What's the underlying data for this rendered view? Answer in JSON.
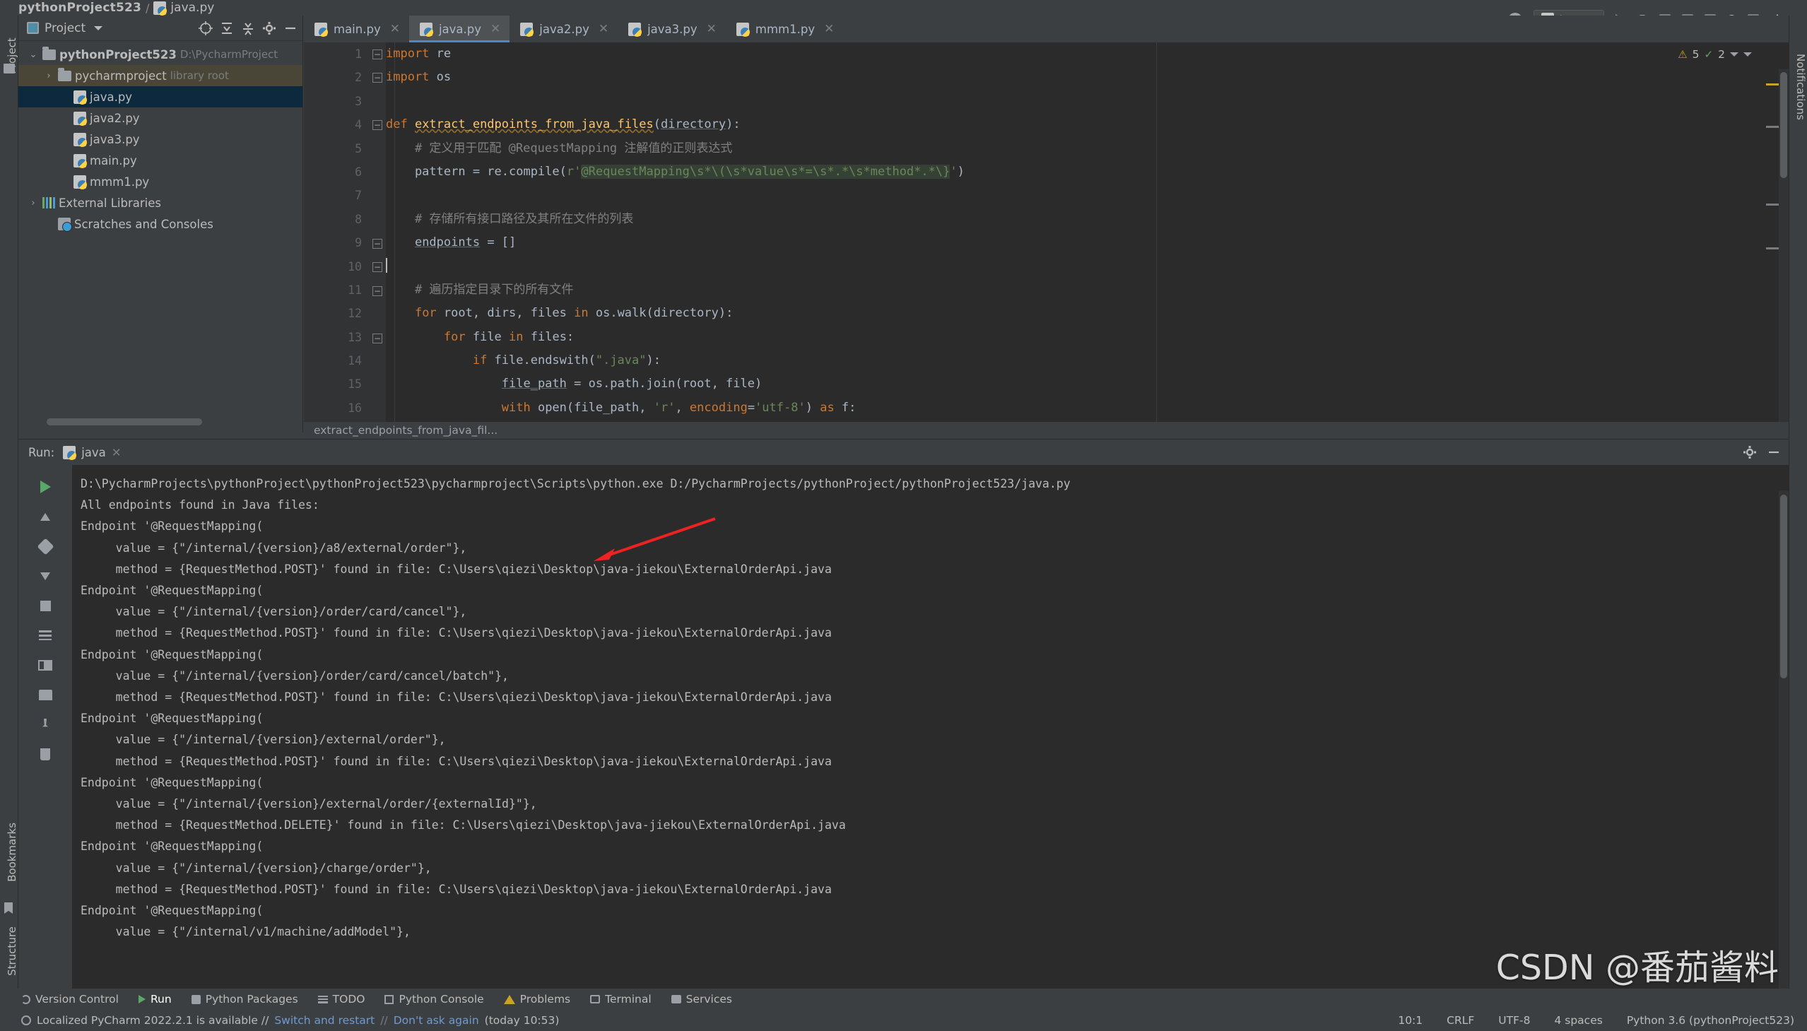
{
  "breadcrumb": {
    "project": "pythonProject523",
    "separator": "/",
    "file": "java.py"
  },
  "left_strip": {
    "project_label": "Project",
    "bookmarks_label": "Bookmarks",
    "structure_label": "Structure"
  },
  "right_strip": {
    "notifications_label": "Notifications"
  },
  "project_panel": {
    "title": "Project",
    "tree": [
      {
        "label": "pythonProject523",
        "hint": "D:\\PycharmProject",
        "icon": "folder-icon",
        "bold": true,
        "arrow": "⌄",
        "depth": 0,
        "state": "normal"
      },
      {
        "label": "pycharmproject",
        "hint": "library root",
        "icon": "folder-icon",
        "bold": false,
        "arrow": "›",
        "depth": 1,
        "state": "highlight"
      },
      {
        "label": "java.py",
        "hint": "",
        "icon": "python-file-icon",
        "bold": false,
        "arrow": "",
        "depth": 2,
        "state": "selected"
      },
      {
        "label": "java2.py",
        "hint": "",
        "icon": "python-file-icon",
        "bold": false,
        "arrow": "",
        "depth": 2,
        "state": "normal"
      },
      {
        "label": "java3.py",
        "hint": "",
        "icon": "python-file-icon",
        "bold": false,
        "arrow": "",
        "depth": 2,
        "state": "normal"
      },
      {
        "label": "main.py",
        "hint": "",
        "icon": "python-file-icon",
        "bold": false,
        "arrow": "",
        "depth": 2,
        "state": "normal"
      },
      {
        "label": "mmm1.py",
        "hint": "",
        "icon": "python-file-icon",
        "bold": false,
        "arrow": "",
        "depth": 2,
        "state": "normal"
      },
      {
        "label": "External Libraries",
        "hint": "",
        "icon": "library-icon",
        "bold": false,
        "arrow": "›",
        "depth": 0,
        "state": "normal"
      },
      {
        "label": "Scratches and Consoles",
        "hint": "",
        "icon": "scratches-icon",
        "bold": false,
        "arrow": "",
        "depth": 1,
        "state": "normal"
      }
    ]
  },
  "editor": {
    "tabs": [
      {
        "label": "main.py",
        "active": false
      },
      {
        "label": "java.py",
        "active": true
      },
      {
        "label": "java2.py",
        "active": false
      },
      {
        "label": "java3.py",
        "active": false
      },
      {
        "label": "mmm1.py",
        "active": false
      }
    ],
    "inspection": {
      "warnings": "5",
      "checks": "2"
    },
    "breadcrumb_bottom": "extract_endpoints_from_java_fil...",
    "line_numbers": [
      "1",
      "2",
      "3",
      "4",
      "5",
      "6",
      "7",
      "8",
      "9",
      "10",
      "11",
      "12",
      "13",
      "14",
      "15",
      "16"
    ],
    "code": [
      {
        "n": 1,
        "tokens": [
          {
            "t": "import",
            "c": "kw"
          },
          {
            "t": " re",
            "c": "var"
          }
        ]
      },
      {
        "n": 2,
        "tokens": [
          {
            "t": "import",
            "c": "kw"
          },
          {
            "t": " os",
            "c": "var"
          }
        ]
      },
      {
        "n": 3,
        "tokens": []
      },
      {
        "n": 4,
        "tokens": [
          {
            "t": "def ",
            "c": "kw"
          },
          {
            "t": "extract_endpoints_from_java_files",
            "c": "fndef"
          },
          {
            "t": "(",
            "c": "var"
          },
          {
            "t": "directory",
            "c": "varu"
          },
          {
            "t": "):",
            "c": "var"
          }
        ]
      },
      {
        "n": 5,
        "tokens": [
          {
            "t": "    # 定义用于匹配 @RequestMapping 注解值的正则表达式",
            "c": "cmt"
          }
        ]
      },
      {
        "n": 6,
        "tokens": [
          {
            "t": "    pattern = re.compile(",
            "c": "var"
          },
          {
            "t": "r'",
            "c": "str"
          },
          {
            "t": "@RequestMapping\\s*\\(\\s*value\\s*=\\s*.*\\s*method*.*\\",
            "c": "strhl"
          },
          {
            "t": "}",
            "c": "strhl"
          },
          {
            "t": "'",
            "c": "str"
          },
          {
            "t": ")",
            "c": "var"
          }
        ]
      },
      {
        "n": 7,
        "tokens": []
      },
      {
        "n": 8,
        "tokens": [
          {
            "t": "    # 存储所有接口路径及其所在文件的列表",
            "c": "cmt"
          }
        ]
      },
      {
        "n": 9,
        "tokens": [
          {
            "t": "    ",
            "c": "var"
          },
          {
            "t": "endpoints",
            "c": "varu"
          },
          {
            "t": " = []",
            "c": "var"
          }
        ]
      },
      {
        "n": 10,
        "tokens": [],
        "caret": true
      },
      {
        "n": 11,
        "tokens": [
          {
            "t": "    # 遍历指定目录下的所有文件",
            "c": "cmt"
          }
        ]
      },
      {
        "n": 12,
        "tokens": [
          {
            "t": "    ",
            "c": "var"
          },
          {
            "t": "for",
            "c": "kw"
          },
          {
            "t": " root, dirs, files ",
            "c": "var"
          },
          {
            "t": "in",
            "c": "kw"
          },
          {
            "t": " os.walk(directory):",
            "c": "var"
          }
        ]
      },
      {
        "n": 13,
        "tokens": [
          {
            "t": "        ",
            "c": "var"
          },
          {
            "t": "for",
            "c": "kw"
          },
          {
            "t": " file ",
            "c": "var"
          },
          {
            "t": "in",
            "c": "kw"
          },
          {
            "t": " files:",
            "c": "var"
          }
        ]
      },
      {
        "n": 14,
        "tokens": [
          {
            "t": "            ",
            "c": "var"
          },
          {
            "t": "if",
            "c": "kw"
          },
          {
            "t": " file.endswith(",
            "c": "var"
          },
          {
            "t": "\".java\"",
            "c": "str"
          },
          {
            "t": "):",
            "c": "var"
          }
        ]
      },
      {
        "n": 15,
        "tokens": [
          {
            "t": "                ",
            "c": "var"
          },
          {
            "t": "file_path",
            "c": "varu"
          },
          {
            "t": " = os.path.join(root, file)",
            "c": "var"
          }
        ]
      },
      {
        "n": 16,
        "tokens": [
          {
            "t": "                ",
            "c": "var"
          },
          {
            "t": "with",
            "c": "kw"
          },
          {
            "t": " open(file_path, ",
            "c": "var"
          },
          {
            "t": "'r'",
            "c": "str"
          },
          {
            "t": ", ",
            "c": "var"
          },
          {
            "t": "encoding",
            "c": "kw"
          },
          {
            "t": "=",
            "c": "var"
          },
          {
            "t": "'utf-8'",
            "c": "str"
          },
          {
            "t": ") ",
            "c": "var"
          },
          {
            "t": "as",
            "c": "kw"
          },
          {
            "t": " f:",
            "c": "var"
          }
        ]
      }
    ]
  },
  "run_panel": {
    "label": "Run:",
    "tab": "java",
    "console": [
      "D:\\PycharmProjects\\pythonProject\\pythonProject523\\pycharmproject\\Scripts\\python.exe D:/PycharmProjects/pythonProject/pythonProject523/java.py",
      "All endpoints found in Java files:",
      "Endpoint '@RequestMapping(",
      "     value = {\"/internal/{version}/a8/external/order\"},",
      "     method = {RequestMethod.POST}' found in file: C:\\Users\\qiezi\\Desktop\\java-jiekou\\ExternalOrderApi.java",
      "Endpoint '@RequestMapping(",
      "     value = {\"/internal/{version}/order/card/cancel\"},",
      "     method = {RequestMethod.POST}' found in file: C:\\Users\\qiezi\\Desktop\\java-jiekou\\ExternalOrderApi.java",
      "Endpoint '@RequestMapping(",
      "     value = {\"/internal/{version}/order/card/cancel/batch\"},",
      "     method = {RequestMethod.POST}' found in file: C:\\Users\\qiezi\\Desktop\\java-jiekou\\ExternalOrderApi.java",
      "Endpoint '@RequestMapping(",
      "     value = {\"/internal/{version}/external/order\"},",
      "     method = {RequestMethod.POST}' found in file: C:\\Users\\qiezi\\Desktop\\java-jiekou\\ExternalOrderApi.java",
      "Endpoint '@RequestMapping(",
      "     value = {\"/internal/{version}/external/order/{externalId}\"},",
      "     method = {RequestMethod.DELETE}' found in file: C:\\Users\\qiezi\\Desktop\\java-jiekou\\ExternalOrderApi.java",
      "Endpoint '@RequestMapping(",
      "     value = {\"/internal/{version}/charge/order\"},",
      "     method = {RequestMethod.POST}' found in file: C:\\Users\\qiezi\\Desktop\\java-jiekou\\ExternalOrderApi.java",
      "Endpoint '@RequestMapping(",
      "     value = {\"/internal/v1/machine/addModel\"},"
    ]
  },
  "tool_window_bar": [
    {
      "label": "Version Control",
      "icon": "version-control-icon",
      "active": false
    },
    {
      "label": "Run",
      "icon": "run-icon",
      "active": true
    },
    {
      "label": "Python Packages",
      "icon": "python-packages-icon",
      "active": false
    },
    {
      "label": "TODO",
      "icon": "todo-icon",
      "active": false
    },
    {
      "label": "Python Console",
      "icon": "python-console-icon",
      "active": false
    },
    {
      "label": "Problems",
      "icon": "problems-icon",
      "active": false
    },
    {
      "label": "Terminal",
      "icon": "terminal-icon",
      "active": false
    },
    {
      "label": "Services",
      "icon": "services-icon",
      "active": false
    }
  ],
  "status_bar": {
    "message_prefix": "Localized PyCharm 2022.2.1 is available //",
    "link_update": "Switch and restart",
    "sep1": "//",
    "link_dismiss": "Don't ask again",
    "timestamp": "(today 10:53)",
    "caret_position": "10:1",
    "line_separator": "CRLF",
    "encoding": "UTF-8",
    "indent": "4 spaces",
    "interpreter": "Python 3.6 (pythonProject523)"
  },
  "run_config": {
    "name": "java"
  },
  "watermark": "CSDN @番茄酱料",
  "colors": {
    "background": "#2b2b2b",
    "panel": "#3c3f41",
    "selection": "#0d293e",
    "accent": "#4a88c7",
    "keyword": "#cc7832",
    "string": "#6a8759",
    "function": "#ffc66d",
    "comment": "#808080",
    "arrow_annotation": "#ee2222"
  }
}
